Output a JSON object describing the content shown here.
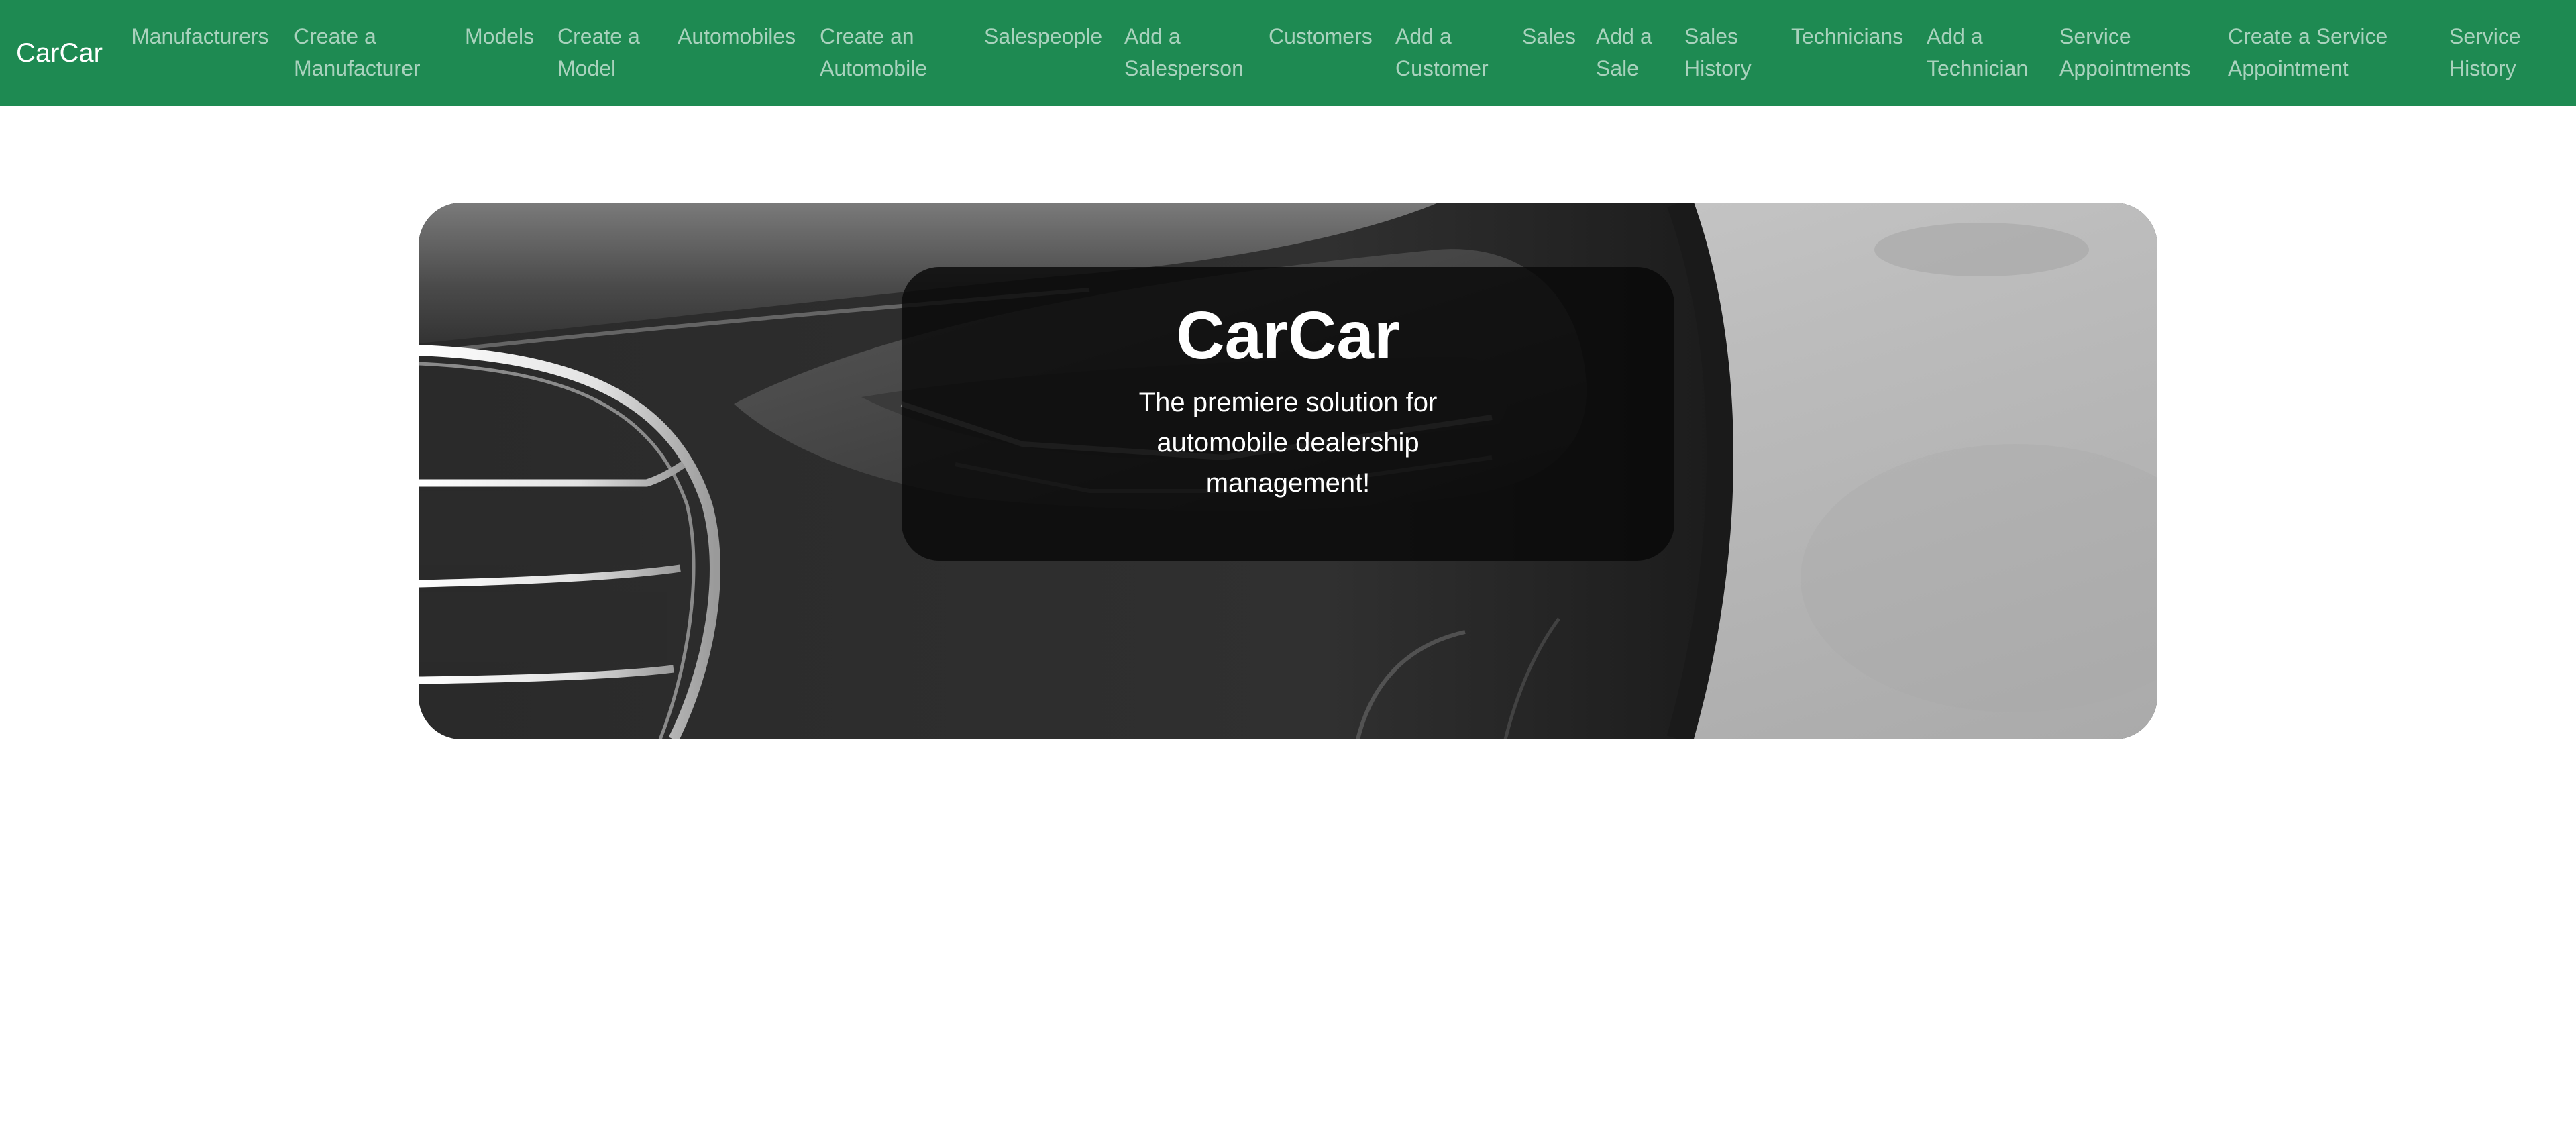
{
  "navbar": {
    "brand": "CarCar",
    "links": [
      {
        "line1": "Manufacturers",
        "line2": ""
      },
      {
        "line1": "Create a",
        "line2": "Manufacturer"
      },
      {
        "line1": "Models",
        "line2": ""
      },
      {
        "line1": "Create a",
        "line2": "Model"
      },
      {
        "line1": "Automobiles",
        "line2": ""
      },
      {
        "line1": "Create an",
        "line2": "Automobile"
      },
      {
        "line1": "Salespeople",
        "line2": ""
      },
      {
        "line1": "Add a",
        "line2": "Salesperson"
      },
      {
        "line1": "Customers",
        "line2": ""
      },
      {
        "line1": "Add a",
        "line2": "Customer"
      },
      {
        "line1": "Sales",
        "line2": ""
      },
      {
        "line1": "Add a",
        "line2": "Sale"
      },
      {
        "line1": "Sales",
        "line2": "History"
      },
      {
        "line1": "Technicians",
        "line2": ""
      },
      {
        "line1": "Add a",
        "line2": "Technician"
      },
      {
        "line1": "Service",
        "line2": "Appointments"
      },
      {
        "line1": "Create a Service",
        "line2": "Appointment"
      },
      {
        "line1": "Service",
        "line2": "History"
      }
    ]
  },
  "hero": {
    "title": "CarCar",
    "subtitle": "The premiere solution for automobile dealership management!"
  },
  "colors": {
    "navbar_bg": "#1e8a52",
    "nav_link": "rgba(255,255,255,0.62)",
    "hero_card_bg": "rgba(8,8,8,0.82)"
  }
}
